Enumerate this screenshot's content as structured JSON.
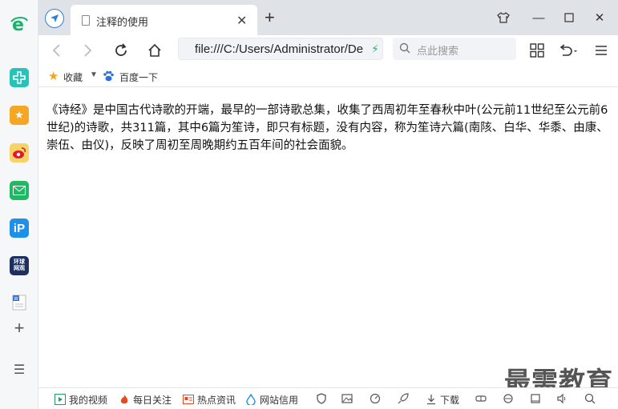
{
  "browser": {
    "tab_title": "注释的使用",
    "address": "file:///C:/Users/Administrator/De",
    "search_placeholder": "点此搜索"
  },
  "bookmarks": {
    "favorites_label": "收藏",
    "baidu_label": "百度一下"
  },
  "content": {
    "paragraph": "《诗经》是中国古代诗歌的开端，最早的一部诗歌总集，收集了西周初年至春秋中叶(公元前11世纪至公元前6世纪)的诗歌，共311篇，其中6篇为笙诗，即只有标题，没有内容，称为笙诗六篇(南陔、白华、华黍、由康、崇伍、由仪)，反映了周初至周晚期约五百年间的社会面貌。"
  },
  "watermark": "最需教育",
  "statusbar": {
    "my_video": "我的视频",
    "daily": "每日关注",
    "hot_news": "热点资讯",
    "site_app": "网站信用",
    "download": "下载"
  },
  "sidebar": {
    "news_label": "环球\n网观"
  },
  "colors": {
    "accent": "#2f7ed8",
    "bolt": "#28b463",
    "star": "#f2a41c"
  }
}
